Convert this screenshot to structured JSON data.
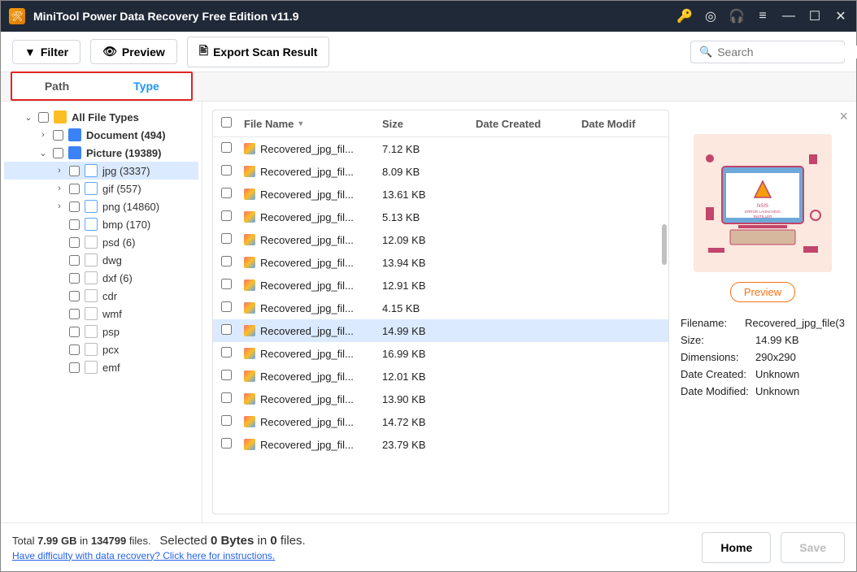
{
  "titlebar": {
    "title": "MiniTool Power Data Recovery Free Edition v11.9"
  },
  "toolbar": {
    "filter": "Filter",
    "preview": "Preview",
    "export": "Export Scan Result",
    "search_placeholder": "Search"
  },
  "tabs": {
    "path": "Path",
    "type": "Type"
  },
  "tree": {
    "root": "All File Types",
    "document": "Document (494)",
    "picture": "Picture (19389)",
    "jpg": "jpg (3337)",
    "gif": "gif (557)",
    "png": "png (14860)",
    "bmp": "bmp (170)",
    "psd": "psd (6)",
    "dwg": "dwg",
    "dxf": "dxf (6)",
    "cdr": "cdr",
    "wmf": "wmf",
    "psp": "psp",
    "pcx": "pcx",
    "emf": "emf"
  },
  "columns": {
    "name": "File Name",
    "size": "Size",
    "date_created": "Date Created",
    "date_modified": "Date Modif"
  },
  "files": [
    {
      "name": "Recovered_jpg_fil...",
      "size": "7.12 KB"
    },
    {
      "name": "Recovered_jpg_fil...",
      "size": "8.09 KB"
    },
    {
      "name": "Recovered_jpg_fil...",
      "size": "13.61 KB"
    },
    {
      "name": "Recovered_jpg_fil...",
      "size": "5.13 KB"
    },
    {
      "name": "Recovered_jpg_fil...",
      "size": "12.09 KB"
    },
    {
      "name": "Recovered_jpg_fil...",
      "size": "13.94 KB"
    },
    {
      "name": "Recovered_jpg_fil...",
      "size": "12.91 KB"
    },
    {
      "name": "Recovered_jpg_fil...",
      "size": "4.15 KB"
    },
    {
      "name": "Recovered_jpg_fil...",
      "size": "14.99 KB",
      "selected": true
    },
    {
      "name": "Recovered_jpg_fil...",
      "size": "16.99 KB"
    },
    {
      "name": "Recovered_jpg_fil...",
      "size": "12.01 KB"
    },
    {
      "name": "Recovered_jpg_fil...",
      "size": "13.90 KB"
    },
    {
      "name": "Recovered_jpg_fil...",
      "size": "14.72 KB"
    },
    {
      "name": "Recovered_jpg_fil...",
      "size": "23.79 KB"
    }
  ],
  "preview": {
    "button": "Preview",
    "meta": {
      "filename_k": "Filename:",
      "filename_v": "Recovered_jpg_file(3",
      "size_k": "Size:",
      "size_v": "14.99 KB",
      "dim_k": "Dimensions:",
      "dim_v": "290x290",
      "dc_k": "Date Created:",
      "dc_v": "Unknown",
      "dm_k": "Date Modified:",
      "dm_v": "Unknown"
    }
  },
  "status": {
    "total_prefix": "Total ",
    "total_size": "7.99 GB",
    "in": " in ",
    "total_files": "134799",
    "files_suffix": " files.",
    "selected_prefix": "Selected ",
    "selected_bytes": "0 Bytes",
    "selected_in": " in ",
    "selected_count": "0",
    "selected_suffix": " files.",
    "help_link": "Have difficulty with data recovery? Click here for instructions.",
    "home": "Home",
    "save": "Save"
  }
}
